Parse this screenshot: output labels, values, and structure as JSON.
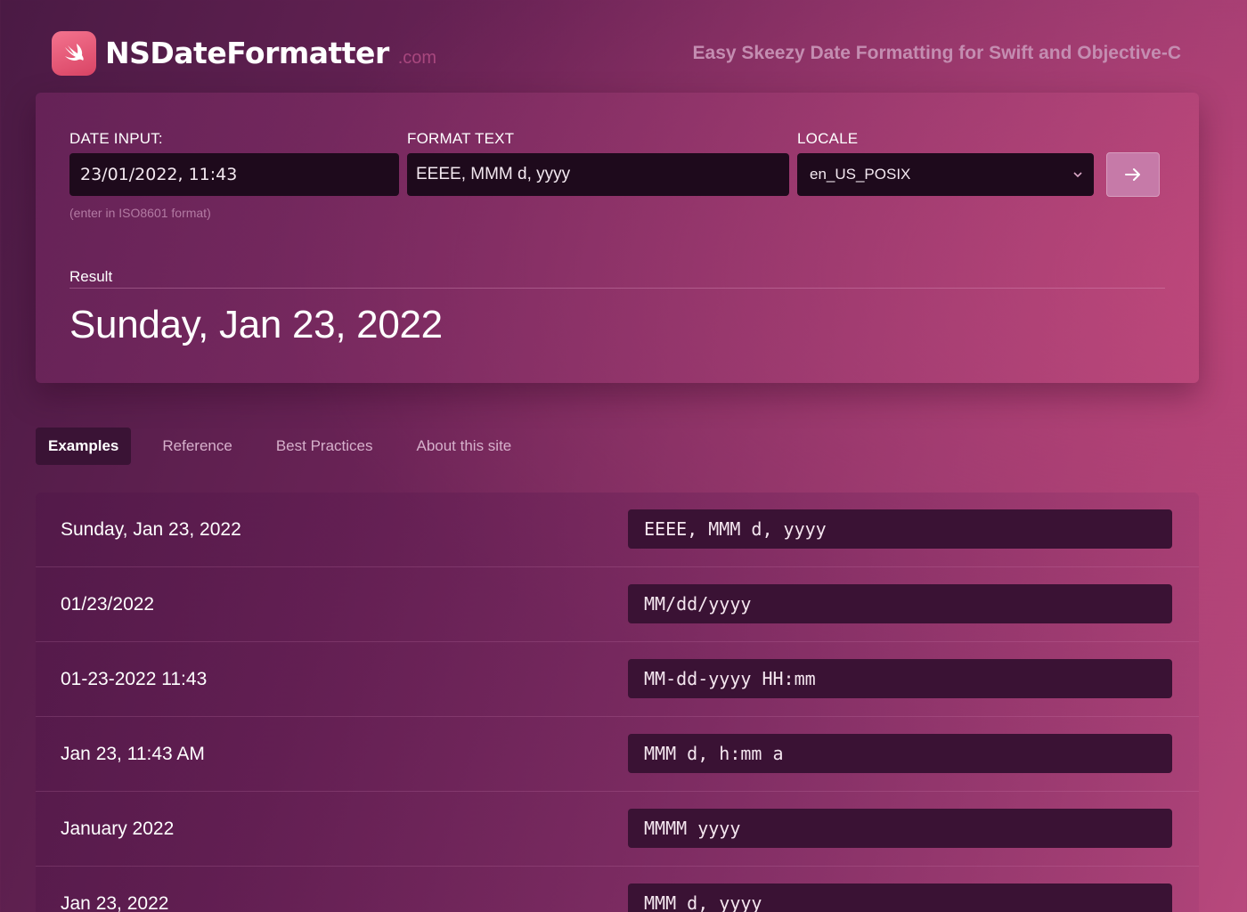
{
  "brand": {
    "name": "NSDateFormatter",
    "tld": ".com",
    "tagline": "Easy Skeezy Date Formatting for Swift and Objective-C",
    "logo_icon": "swift-logo-icon"
  },
  "form": {
    "date_label": "DATE INPUT:",
    "date_value": "23/01/2022, 11:43",
    "date_hint": "(enter in ISO8601 format)",
    "format_label": "FORMAT TEXT",
    "format_value": "EEEE, MMM d, yyyy",
    "locale_label": "LOCALE",
    "locale_value": "en_US_POSIX",
    "submit_icon": "arrow-right-icon"
  },
  "result": {
    "label": "Result",
    "value": "Sunday, Jan 23, 2022"
  },
  "tabs": [
    {
      "label": "Examples",
      "active": true
    },
    {
      "label": "Reference",
      "active": false
    },
    {
      "label": "Best Practices",
      "active": false
    },
    {
      "label": "About this site",
      "active": false
    }
  ],
  "examples": [
    {
      "output": "Sunday, Jan 23, 2022",
      "format": "EEEE, MMM d, yyyy"
    },
    {
      "output": "01/23/2022",
      "format": "MM/dd/yyyy"
    },
    {
      "output": "01-23-2022 11:43",
      "format": "MM-dd-yyyy HH:mm"
    },
    {
      "output": "Jan 23, 11:43 AM",
      "format": "MMM d, h:mm a"
    },
    {
      "output": "January 2022",
      "format": "MMMM yyyy"
    },
    {
      "output": "Jan 23, 2022",
      "format": "MMM d, yyyy"
    }
  ],
  "colors": {
    "accent": "#d94465",
    "field_bg": "#1e0a1c",
    "button_bg": "#c67aa8"
  }
}
